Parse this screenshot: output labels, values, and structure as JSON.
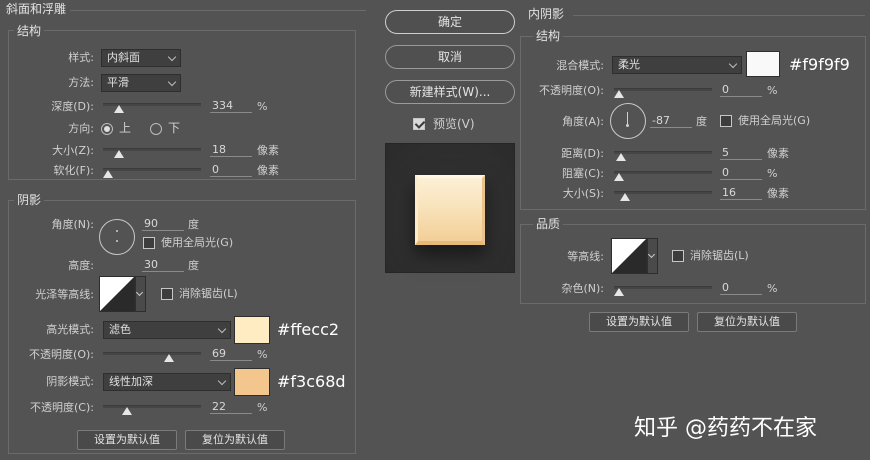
{
  "bevel": {
    "section_title": "斜面和浮雕",
    "structure_title": "结构",
    "style_label": "样式:",
    "style_value": "内斜面",
    "technique_label": "方法:",
    "technique_value": "平滑",
    "depth_label": "深度(D):",
    "depth_value": "334",
    "depth_unit": "%",
    "depth_level": 0.12,
    "direction_label": "方向:",
    "direction_up": "上",
    "direction_down": "下",
    "size_label": "大小(Z):",
    "size_value": "18",
    "size_unit": "像素",
    "size_level": 0.13,
    "soften_label": "软化(F):",
    "soften_value": "0",
    "soften_unit": "像素",
    "soften_level": 0.0
  },
  "shading": {
    "title": "阴影",
    "angle_label": "角度(N):",
    "angle_value": "90",
    "angle_unit": "度",
    "use_global_light": "使用全局光(G)",
    "altitude_label": "高度:",
    "altitude_value": "30",
    "altitude_unit": "度",
    "gloss_contour_label": "光泽等高线:",
    "anti_aliased": "消除锯齿(L)",
    "highlight_mode_label": "高光模式:",
    "highlight_mode_value": "滤色",
    "highlight_color": "#ffecc2",
    "highlight_hex": "#ffecc2",
    "highlight_opacity_label": "不透明度(O):",
    "highlight_opacity_value": "69",
    "highlight_opacity_unit": "%",
    "highlight_opacity_level": 0.69,
    "shadow_mode_label": "阴影模式:",
    "shadow_mode_value": "线性加深",
    "shadow_color": "#f3c68d",
    "shadow_hex": "#f3c68d",
    "shadow_opacity_label": "不透明度(C):",
    "shadow_opacity_value": "22",
    "shadow_opacity_unit": "%",
    "shadow_opacity_level": 0.22,
    "make_default": "设置为默认值",
    "reset_default": "复位为默认值"
  },
  "center": {
    "ok": "确定",
    "cancel": "取消",
    "new_style": "新建样式(W)...",
    "preview": "预览(V)",
    "preview_checked": true
  },
  "inner_shadow": {
    "section_title": "内阴影",
    "structure_title": "结构",
    "blend_label": "混合模式:",
    "blend_value": "柔光",
    "color": "#f9f9f9",
    "color_hex": "#f9f9f9",
    "opacity_label": "不透明度(O):",
    "opacity_value": "0",
    "opacity_unit": "%",
    "opacity_level": 0.0,
    "angle_label": "角度(A):",
    "angle_value": "-87",
    "angle_unit": "度",
    "use_global_light": "使用全局光(G)",
    "distance_label": "距离(D):",
    "distance_value": "5",
    "distance_unit": "像素",
    "distance_level": 0.02,
    "choke_label": "阻塞(C):",
    "choke_value": "0",
    "choke_unit": "%",
    "choke_level": 0.0,
    "size_label": "大小(S):",
    "size_value": "16",
    "size_unit": "像素",
    "size_level": 0.07,
    "quality_title": "品质",
    "contour_label": "等高线:",
    "anti_aliased": "消除锯齿(L)",
    "noise_label": "杂色(N):",
    "noise_value": "0",
    "noise_unit": "%",
    "noise_level": 0.0,
    "make_default": "设置为默认值",
    "reset_default": "复位为默认值"
  },
  "watermark": "知乎 @药药不在家"
}
